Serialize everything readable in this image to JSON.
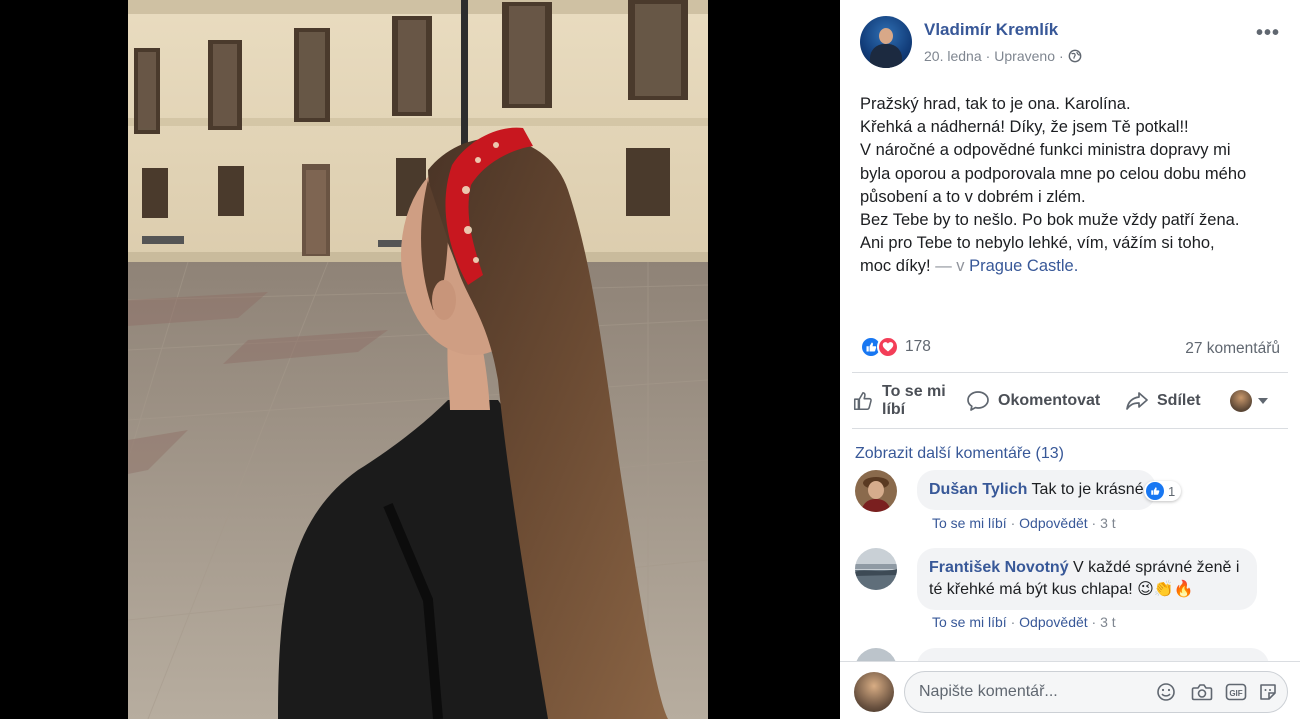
{
  "post": {
    "author": "Vladimír Kremlík",
    "date": "20. ledna",
    "edited": "Upraveno",
    "separator": "·",
    "more_icon": "more-horizontal-icon",
    "privacy_icon": "globe-icon",
    "text_lines": [
      "Pražský hrad, tak to je ona. Karolína.",
      "Křehká a nádherná! Díky, že jsem Tě potkal!!",
      "V náročné a odpovědné funkci ministra dopravy mi",
      "byla oporou a podporovala mne po celou dobu mého",
      "působení a to v dobrém i zlém.",
      "Bez Tebe by to nešlo. Po bok muže vždy patří žena.",
      "Ani pro Tebe to nebylo lehké, vím, vážím si toho,"
    ],
    "last_line_text": "moc díky!",
    "with_text": " — v ",
    "place": "Prague Castle",
    "place_end": "."
  },
  "stats": {
    "reactions_count": "178",
    "comments_count": "27 komentářů",
    "reaction_icons": [
      "like-icon",
      "love-icon"
    ]
  },
  "actions": {
    "like": "To se mi líbí",
    "comment": "Okomentovat",
    "share": "Sdílet"
  },
  "comments_section": {
    "more": "Zobrazit další komentáře (13)",
    "items": [
      {
        "name": "Dušan Tylich",
        "text": "Tak to je krásné",
        "reaction_count": "1",
        "like": "To se mi líbí",
        "reply": "Odpovědět",
        "time": "3 t"
      },
      {
        "name": "František Novotný",
        "text_line1": "V každé správné ženě i",
        "text_line2": "té křehké má být kus chlapa!",
        "emojis": "😉👏🔥",
        "like": "To se mi líbí",
        "reply": "Odpovědět",
        "time": "3 t"
      }
    ]
  },
  "composer": {
    "placeholder": "Napište komentář...",
    "tools": [
      "emoji-icon",
      "camera-icon",
      "gif-icon",
      "sticker-icon"
    ],
    "gif_label": "GIF"
  },
  "colors": {
    "link": "#385898",
    "like_blue": "#1877f2",
    "love_red": "#f33e58",
    "muted": "#606770",
    "bubble": "#f2f3f5"
  }
}
